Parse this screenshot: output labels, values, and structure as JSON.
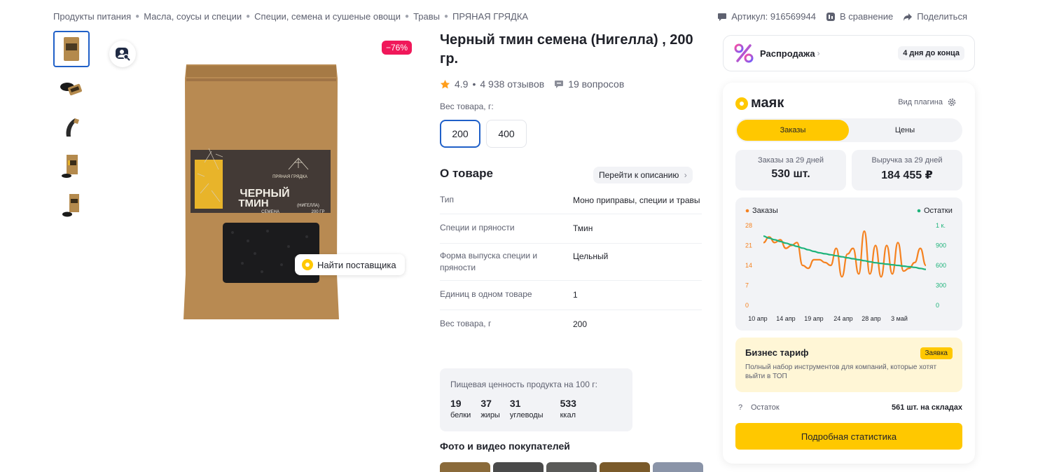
{
  "breadcrumb": [
    "Продукты питания",
    "Масла, соусы и специи",
    "Специи, семена и сушеные овощи",
    "Травы",
    "ПРЯНАЯ ГРЯДКА"
  ],
  "top_actions": {
    "article_label": "Артикул: 916569944",
    "compare_label": "В сравнение",
    "share_label": "Поделиться"
  },
  "gallery": {
    "discount": "−76%",
    "find_supplier": "Найти поставщика",
    "thumbnail_count": 5,
    "package_text": {
      "brand": "ПРЯНАЯ ГРЯДКА",
      "line1": "ЧЕРНЫЙ",
      "line2": "ТМИН",
      "line3": "(НИГЕЛЛА)",
      "line4": "СЕМЕНА",
      "weight": "200 ГР"
    }
  },
  "product": {
    "title": "Черный тмин семена (Нигелла) , 200 гр.",
    "rating": "4.9",
    "reviews": "4 938 отзывов",
    "questions": "19 вопросов",
    "weight_label": "Вес товара, г:",
    "weight_options": [
      {
        "label": "200",
        "selected": true
      },
      {
        "label": "400",
        "selected": false
      }
    ]
  },
  "about": {
    "title": "О товаре",
    "link": "Перейти к описанию",
    "properties": [
      {
        "key": "Тип",
        "value": "Моно приправы, специи и травы"
      },
      {
        "key": "Специи и пряности",
        "value": "Тмин"
      },
      {
        "key": "Форма выпуска специи и пряности",
        "value": "Цельный"
      },
      {
        "key": "Единиц в одном товаре",
        "value": "1"
      },
      {
        "key": "Вес товара, г",
        "value": "200"
      }
    ]
  },
  "nutrition": {
    "title": "Пищевая ценность продукта на 100 г:",
    "items": [
      {
        "value": "19",
        "label": "белки"
      },
      {
        "value": "37",
        "label": "жиры"
      },
      {
        "value": "31",
        "label": "углеводы"
      },
      {
        "value": "533",
        "label": "ккал"
      }
    ]
  },
  "photos_title": "Фото и видео покупателей",
  "sale": {
    "label": "Распродажа",
    "chevron": "›",
    "days_left": "4 дня до конца"
  },
  "plugin": {
    "logo": "маяк",
    "view_label": "Вид плагина",
    "tabs": [
      {
        "label": "Заказы",
        "active": true
      },
      {
        "label": "Цены",
        "active": false
      }
    ],
    "stats": [
      {
        "label": "Заказы за 29 дней",
        "value": "530 шт."
      },
      {
        "label": "Выручка за 29 дней",
        "value": "184 455 ₽"
      }
    ],
    "business": {
      "title": "Бизнес тариф",
      "tag": "Заявка",
      "desc": "Полный набор инструментов для компаний, которые хотят выйти в ТОП"
    },
    "stock_label": "Остаток",
    "stock_help": "?",
    "stock_value": "561 шт. на складах",
    "detail_button": "Подробная статистика"
  },
  "colors": {
    "accent_yellow": "#ffc800",
    "orders_line": "#f58220",
    "stock_line": "#1db37a",
    "discount": "#f0185a",
    "selected_border": "#2060c8"
  },
  "chart_data": {
    "type": "line",
    "title": "",
    "x_ticks": [
      "10 апр",
      "14 апр",
      "19 апр",
      "24 апр",
      "28 апр",
      "3 май"
    ],
    "left_axis": {
      "ticks": [
        "0",
        "7",
        "14",
        "21",
        "28"
      ],
      "min": 0,
      "max": 28
    },
    "right_axis": {
      "ticks": [
        "0",
        "300",
        "600",
        "900",
        "1 к."
      ],
      "min": 0,
      "max": 1200
    },
    "series": [
      {
        "name": "Заказы",
        "axis": "left",
        "color": "#f58220",
        "values": [
          22,
          24,
          22,
          23,
          20,
          21,
          22,
          14,
          13,
          16,
          16,
          15,
          14,
          20,
          10,
          18,
          20,
          11,
          26,
          11,
          21,
          10,
          21,
          11,
          22,
          12,
          13,
          15,
          20,
          14
        ]
      },
      {
        "name": "Остатки",
        "axis": "right",
        "color": "#1db37a",
        "values": [
          1040,
          1010,
          985,
          960,
          935,
          910,
          885,
          860,
          835,
          810,
          790,
          775,
          760,
          745,
          730,
          715,
          700,
          685,
          670,
          655,
          640,
          630,
          620,
          610,
          600,
          590,
          580,
          570,
          555,
          540
        ]
      }
    ],
    "legend": "top",
    "grid": false
  }
}
